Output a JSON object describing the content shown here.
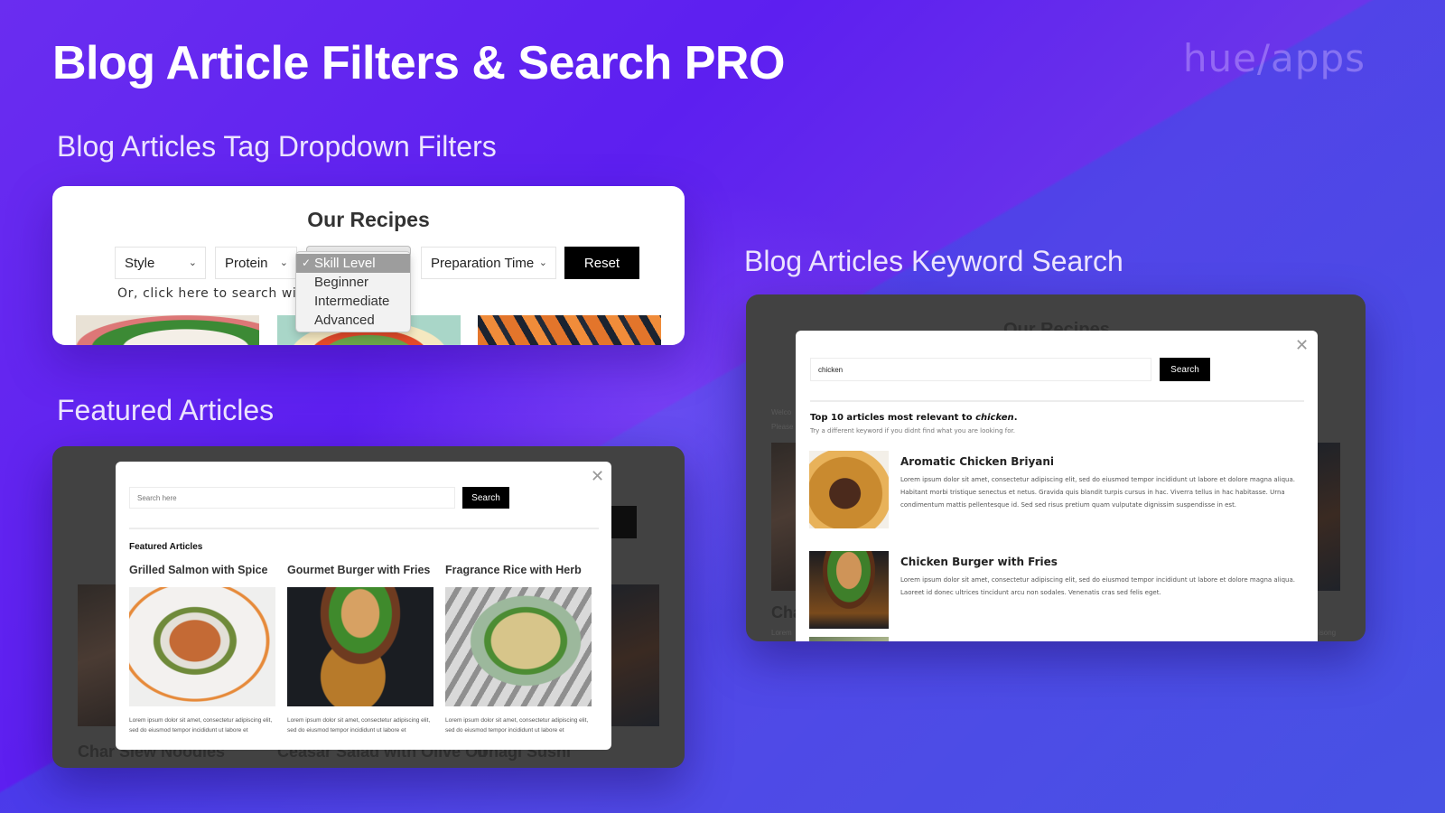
{
  "header": {
    "title": "Blog Article Filters & Search PRO",
    "brand": "hue/apps"
  },
  "sections": {
    "tag_filters": "Blog Articles Tag Dropdown Filters",
    "featured": "Featured Articles",
    "keyword_search": "Blog Articles Keyword Search"
  },
  "tag_panel": {
    "heading": "Our Recipes",
    "filters": [
      {
        "label": "Style"
      },
      {
        "label": "Protein"
      },
      {
        "label": "Skill Level"
      },
      {
        "label": "Preparation Time"
      }
    ],
    "reset_label": "Reset",
    "search_hint": "Or, click here to search wi",
    "dropdown": {
      "selected": "Skill Level",
      "check": "✓",
      "options": [
        "Skill Level",
        "Beginner",
        "Intermediate",
        "Advanced"
      ]
    },
    "chevron": "⌄"
  },
  "featured_panel": {
    "search_placeholder": "Search here",
    "search_button": "Search",
    "close": "✕",
    "label": "Featured Articles",
    "articles": [
      {
        "title": "Grilled Salmon with Spice",
        "excerpt": "Lorem ipsum dolor sit amet, consectetur adipiscing elit, sed do eiusmod tempor incididunt ut labore et"
      },
      {
        "title": "Gourmet Burger with Fries",
        "excerpt": "Lorem ipsum dolor sit amet, consectetur adipiscing elit, sed do eiusmod tempor incididunt ut labore et"
      },
      {
        "title": "Fragrance Rice with Herb",
        "excerpt": "Lorem ipsum dolor sit amet, consectetur adipiscing elit, sed do eiusmod tempor incididunt ut labore et"
      }
    ],
    "background_titles": [
      "Char Siew Noodles",
      "Ceasar Salad with Olive Oil",
      "Unagi Sushi"
    ]
  },
  "search_panel": {
    "background_heading": "Our Recipes",
    "background_text": [
      "Welco",
      "Please",
      "Cha",
      "Lorem",
      "isong"
    ],
    "search_value": "chicken",
    "search_button": "Search",
    "close": "✕",
    "results_title_prefix": "Top 10 articles most relevant to ",
    "results_keyword": "chicken",
    "results_title_suffix": ".",
    "results_subtitle": "Try a different keyword if you didnt find what you are looking for.",
    "results": [
      {
        "title": "Aromatic Chicken Briyani",
        "excerpt": "Lorem ipsum dolor sit amet, consectetur adipiscing elit, sed do eiusmod tempor incididunt ut labore et dolore magna aliqua. Habitant morbi tristique senectus et netus. Gravida quis blandit turpis cursus in hac. Viverra tellus in hac habitasse. Urna condimentum mattis pellentesque id. Sed sed risus pretium quam vulputate dignissim suspendisse in est."
      },
      {
        "title": "Chicken Burger with Fries",
        "excerpt": "Lorem ipsum dolor sit amet, consectetur adipiscing elit, sed do eiusmod tempor incididunt ut labore et dolore magna aliqua. Laoreet id donec ultrices tincidunt arcu non sodales. Venenatis cras sed felis eget."
      }
    ]
  }
}
